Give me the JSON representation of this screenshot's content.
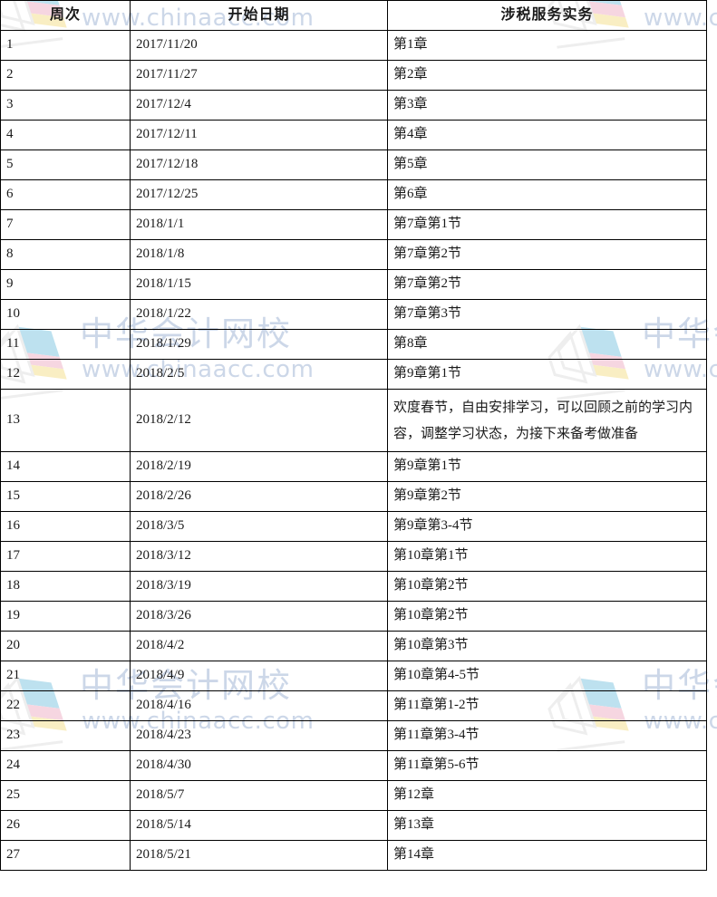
{
  "document": {
    "type": "study-schedule-table",
    "watermark": {
      "brand_text": "中华会计网校",
      "url_text": "www.chinaacc.com",
      "logo_icon": "chinaacc-chevron-logo-icon",
      "text_color": "#ccd7e8",
      "logo_colors": [
        "#a8d8ea",
        "#f3c9d8",
        "#f7e9b0",
        "#e9e9e9"
      ]
    },
    "border_color": "#000000",
    "text_color": "#1a1a1a"
  },
  "table": {
    "columns": [
      {
        "key": "week",
        "label": "周次",
        "align": "center"
      },
      {
        "key": "date",
        "label": "开始日期",
        "align": "center"
      },
      {
        "key": "topic",
        "label": "涉税服务实务",
        "align": "center"
      }
    ],
    "rows": [
      {
        "week": "1",
        "date": "2017/11/20",
        "topic": "第1章"
      },
      {
        "week": "2",
        "date": "2017/11/27",
        "topic": "第2章"
      },
      {
        "week": "3",
        "date": "2017/12/4",
        "topic": "第3章"
      },
      {
        "week": "4",
        "date": "2017/12/11",
        "topic": "第4章"
      },
      {
        "week": "5",
        "date": "2017/12/18",
        "topic": "第5章"
      },
      {
        "week": "6",
        "date": "2017/12/25",
        "topic": "第6章"
      },
      {
        "week": "7",
        "date": "2018/1/1",
        "topic": "第7章第1节"
      },
      {
        "week": "8",
        "date": "2018/1/8",
        "topic": "第7章第2节"
      },
      {
        "week": "9",
        "date": "2018/1/15",
        "topic": "第7章第2节"
      },
      {
        "week": "10",
        "date": "2018/1/22",
        "topic": "第7章第3节"
      },
      {
        "week": "11",
        "date": "2018/1/29",
        "topic": "第8章"
      },
      {
        "week": "12",
        "date": "2018/2/5",
        "topic": "第9章第1节"
      },
      {
        "week": "13",
        "date": "2018/2/12",
        "topic": "欢度春节，自由安排学习，可以回顾之前的学习内容，调整学习状态，为接下来备考做准备",
        "tall": true
      },
      {
        "week": "14",
        "date": "2018/2/19",
        "topic": "第9章第1节"
      },
      {
        "week": "15",
        "date": "2018/2/26",
        "topic": "第9章第2节"
      },
      {
        "week": "16",
        "date": "2018/3/5",
        "topic": "第9章第3-4节"
      },
      {
        "week": "17",
        "date": "2018/3/12",
        "topic": "第10章第1节"
      },
      {
        "week": "18",
        "date": "2018/3/19",
        "topic": "第10章第2节"
      },
      {
        "week": "19",
        "date": "2018/3/26",
        "topic": "第10章第2节"
      },
      {
        "week": "20",
        "date": "2018/4/2",
        "topic": "第10章第3节"
      },
      {
        "week": "21",
        "date": "2018/4/9",
        "topic": "第10章第4-5节"
      },
      {
        "week": "22",
        "date": "2018/4/16",
        "topic": "第11章第1-2节"
      },
      {
        "week": "23",
        "date": "2018/4/23",
        "topic": "第11章第3-4节"
      },
      {
        "week": "24",
        "date": "2018/4/30",
        "topic": "第11章第5-6节"
      },
      {
        "week": "25",
        "date": "2018/5/7",
        "topic": "第12章"
      },
      {
        "week": "26",
        "date": "2018/5/14",
        "topic": "第13章"
      },
      {
        "week": "27",
        "date": "2018/5/21",
        "topic": "第14章"
      }
    ]
  }
}
